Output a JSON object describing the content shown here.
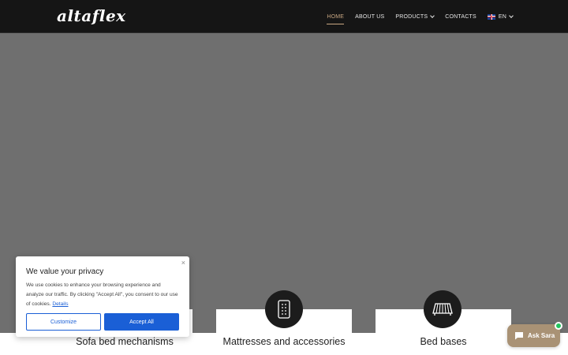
{
  "header": {
    "logo": "altaflex",
    "nav": [
      {
        "label": "HOME"
      },
      {
        "label": "ABOUT US"
      },
      {
        "label": "PRODUCTS"
      },
      {
        "label": "CONTACTS"
      }
    ],
    "language": "EN"
  },
  "cards": [
    {
      "title": "Sofa bed mechanisms"
    },
    {
      "title": "Mattresses and accessories"
    },
    {
      "title": "Bed bases"
    }
  ],
  "cookie": {
    "title": "We value your privacy",
    "text": "We use cookies to enhance your browsing experience and analyze our traffic. By clicking \"Accept All\", you consent to our use of cookies.",
    "details_link": "Details",
    "customize_label": "Customize",
    "accept_label": "Accept All",
    "close_symbol": "×"
  },
  "chat": {
    "label": "Ask Sara"
  },
  "colors": {
    "header_bg": "#151515",
    "hero_bg": "#6f6f6f",
    "accent_gold": "#c9a883",
    "cookie_blue": "#1a5fd6",
    "chat_bg": "#a99275",
    "online_green": "#22c55e"
  }
}
